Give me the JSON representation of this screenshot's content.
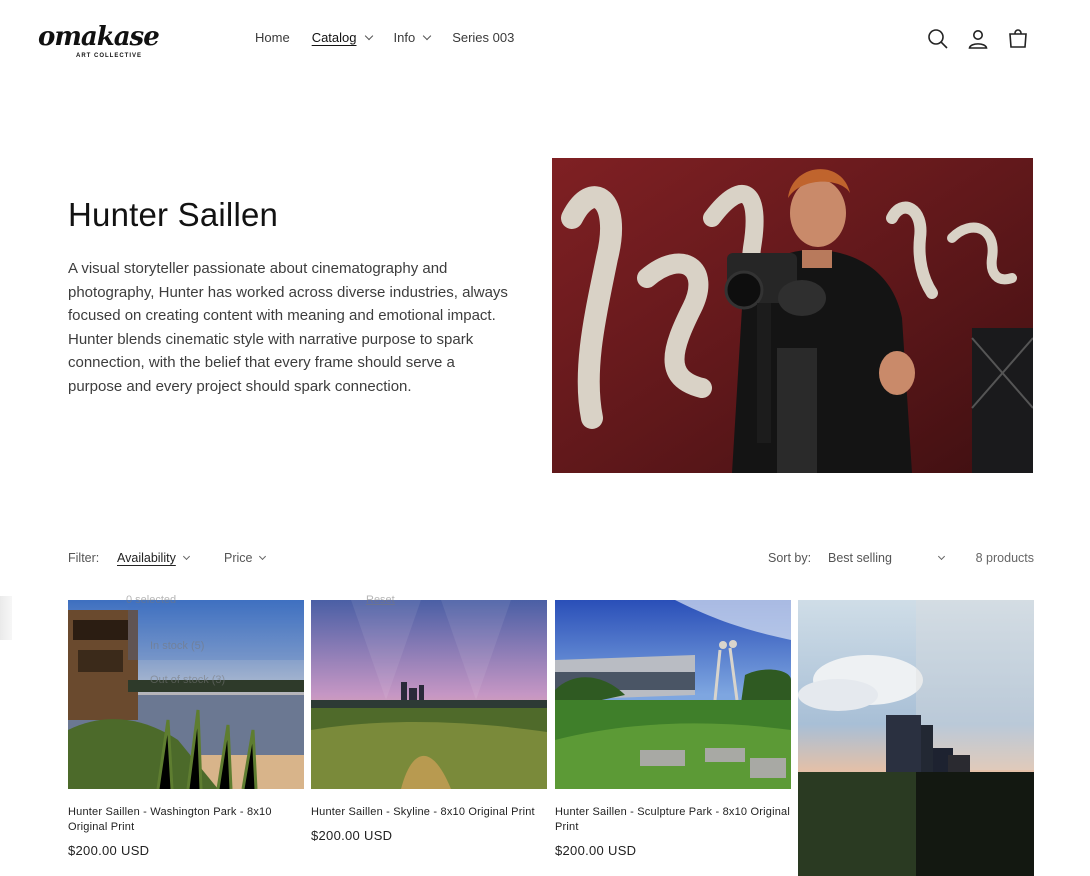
{
  "brand": {
    "logo_text": "omakase",
    "logo_subtitle": "ART COLLECTIVE"
  },
  "nav": {
    "items": [
      {
        "label": "Home",
        "dropdown": false,
        "active": false
      },
      {
        "label": "Catalog",
        "dropdown": true,
        "active": true
      },
      {
        "label": "Info",
        "dropdown": true,
        "active": false
      },
      {
        "label": "Series 003",
        "dropdown": false,
        "active": false
      }
    ]
  },
  "header_icons": [
    "search-icon",
    "account-icon",
    "cart-icon"
  ],
  "hero": {
    "title": "Hunter Saillen",
    "description": "A visual storyteller passionate about cinematography and photography, Hunter has worked across diverse industries, always focused on creating content with meaning and emotional impact. Hunter blends cinematic style with narrative purpose to spark connection, with the belief that every frame should serve a purpose and every project should spark connection."
  },
  "filters": {
    "filter_label": "Filter:",
    "availability_label": "Availability",
    "price_label": "Price",
    "sort_label": "Sort by:",
    "sort_value": "Best selling",
    "product_count": "8 products"
  },
  "availability_dropdown_ghost": {
    "selected": "0 selected",
    "reset": "Reset",
    "option_in_stock": "In stock (5)",
    "option_out_of_stock": "Out of stock (3)"
  },
  "products": [
    {
      "title": "Hunter Saillen - Washington Park - 8x10 Original Print",
      "price": "$200.00 USD"
    },
    {
      "title": "Hunter Saillen - Skyline - 8x10 Original Print",
      "price": "$200.00 USD"
    },
    {
      "title": "Hunter Saillen - Sculpture Park - 8x10 Original Print",
      "price": "$200.00 USD"
    }
  ],
  "colors": {
    "text": "#121212",
    "muted": "#3d3d3d",
    "hero_bg": "#6b1a1d"
  }
}
